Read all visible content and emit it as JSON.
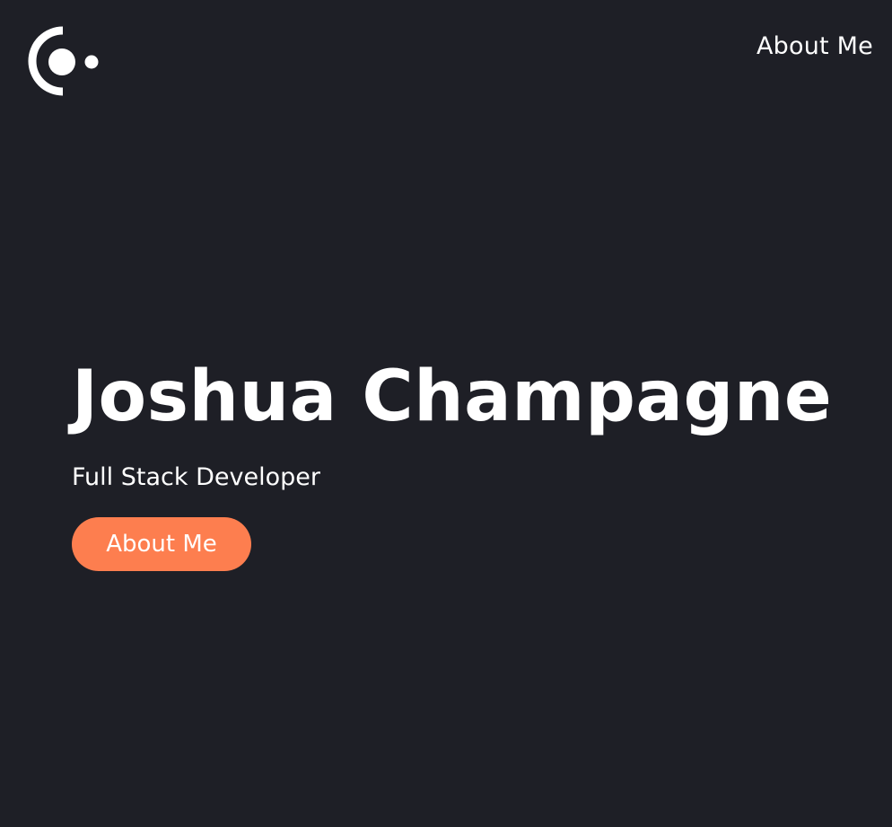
{
  "header": {
    "logo_icon": "orbit-logo-icon",
    "nav": {
      "about_label": "About Me"
    }
  },
  "hero": {
    "name": "Joshua Champagne",
    "tagline": "Full Stack Developer",
    "cta_label": "About Me"
  },
  "colors": {
    "background": "#1e1f26",
    "text": "#ffffff",
    "accent": "#fd7e4f"
  }
}
